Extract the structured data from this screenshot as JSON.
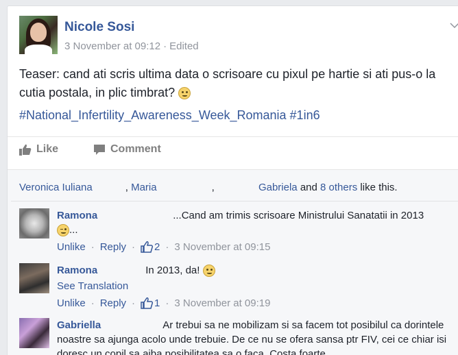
{
  "post": {
    "author": "Nicole Sosi",
    "timestamp": "3 November at 09:12",
    "edited": "Edited",
    "separator": "·",
    "text": "Teaser: cand ati scris ultima data o scrisoare cu pixul pe hartie si ati pus-o la cutia postala, in plic timbrat?",
    "hashtags": "#National_Infertility_Awareness_Week_Romania #1in6"
  },
  "actions": {
    "like": "Like",
    "comment": "Comment"
  },
  "likes_summary": {
    "name1": "Veronica Iuliana",
    "name2": "Maria",
    "name3": "Gabriela",
    "and": "and",
    "others": "8 others",
    "suffix": "like this."
  },
  "comments": [
    {
      "author": "Ramona",
      "text": "...Cand am trimis scrisoare Ministrului Sanatatii in 2013",
      "text2": "...",
      "unlike": "Unlike",
      "reply": "Reply",
      "likes": "2",
      "timestamp": "3 November at 09:15"
    },
    {
      "author": "Ramona",
      "text": "In 2013, da!",
      "see_translation": "See Translation",
      "unlike": "Unlike",
      "reply": "Reply",
      "likes": "1",
      "timestamp": "3 November at 09:19"
    },
    {
      "author": "Gabriella",
      "text": "Ar trebui   sa ne mobilizam si sa facem tot posibilul ca dorintele noastre sa ajunga acolo unde trebuie. De ce nu se ofera sansa ptr FIV, cei ce chiar isi doresc un copil sa aiba posibilitatea sa o faca. Costa foarte"
    }
  ],
  "ui": {
    "dot": "·",
    "chevron": "⌄"
  },
  "colors": {
    "link": "#365899",
    "muted": "#90949c",
    "background": "#e9ebee"
  }
}
